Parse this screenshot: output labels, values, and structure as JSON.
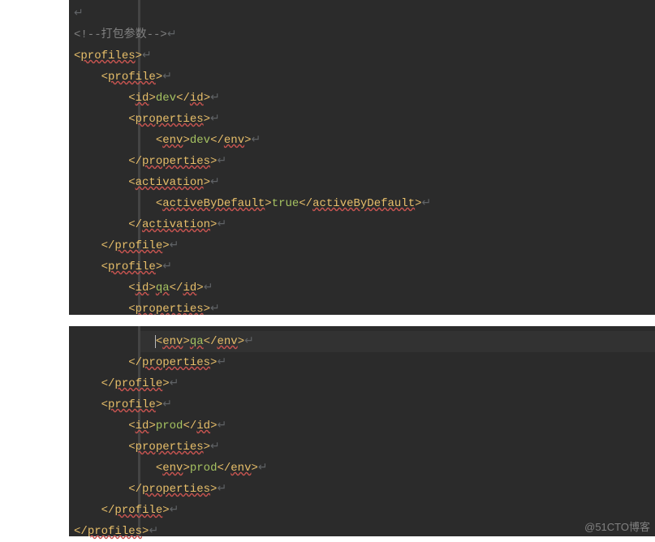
{
  "watermark": "@51CTO博客",
  "arrow_glyph": "↵",
  "lines": [
    {
      "indent": 0,
      "parts": [
        {
          "cls": "arr",
          "text": "↵"
        }
      ]
    },
    {
      "indent": 0,
      "parts": [
        {
          "cls": "cmt",
          "text": "<!--打包参数-->"
        },
        {
          "cls": "arr",
          "text": "↵"
        }
      ]
    },
    {
      "indent": 0,
      "parts": [
        {
          "cls": "tag",
          "text": "<"
        },
        {
          "cls": "tag err",
          "text": "profiles"
        },
        {
          "cls": "tag",
          "text": ">"
        },
        {
          "cls": "arr",
          "text": "↵"
        }
      ]
    },
    {
      "indent": 1,
      "parts": [
        {
          "cls": "tag",
          "text": "<"
        },
        {
          "cls": "tag err",
          "text": "profile"
        },
        {
          "cls": "tag",
          "text": ">"
        },
        {
          "cls": "arr",
          "text": "↵"
        }
      ]
    },
    {
      "indent": 2,
      "parts": [
        {
          "cls": "tag",
          "text": "<"
        },
        {
          "cls": "tag err",
          "text": "id"
        },
        {
          "cls": "tag",
          "text": ">"
        },
        {
          "cls": "text",
          "text": "dev"
        },
        {
          "cls": "tag",
          "text": "</"
        },
        {
          "cls": "tag err",
          "text": "id"
        },
        {
          "cls": "tag",
          "text": ">"
        },
        {
          "cls": "arr",
          "text": "↵"
        }
      ]
    },
    {
      "indent": 2,
      "parts": [
        {
          "cls": "tag",
          "text": "<"
        },
        {
          "cls": "tag err",
          "text": "properties"
        },
        {
          "cls": "tag",
          "text": ">"
        },
        {
          "cls": "arr",
          "text": "↵"
        }
      ]
    },
    {
      "indent": 3,
      "parts": [
        {
          "cls": "tag",
          "text": "<"
        },
        {
          "cls": "tag err",
          "text": "env"
        },
        {
          "cls": "tag",
          "text": ">"
        },
        {
          "cls": "text",
          "text": "dev"
        },
        {
          "cls": "tag",
          "text": "</"
        },
        {
          "cls": "tag err",
          "text": "env"
        },
        {
          "cls": "tag",
          "text": ">"
        },
        {
          "cls": "arr",
          "text": "↵"
        }
      ]
    },
    {
      "indent": 2,
      "parts": [
        {
          "cls": "tag",
          "text": "</"
        },
        {
          "cls": "tag err",
          "text": "properties"
        },
        {
          "cls": "tag",
          "text": ">"
        },
        {
          "cls": "arr",
          "text": "↵"
        }
      ]
    },
    {
      "indent": 2,
      "parts": [
        {
          "cls": "tag",
          "text": "<"
        },
        {
          "cls": "tag err",
          "text": "activation"
        },
        {
          "cls": "tag",
          "text": ">"
        },
        {
          "cls": "arr",
          "text": "↵"
        }
      ]
    },
    {
      "indent": 3,
      "parts": [
        {
          "cls": "tag",
          "text": "<"
        },
        {
          "cls": "tag err",
          "text": "activeByDefault"
        },
        {
          "cls": "tag",
          "text": ">"
        },
        {
          "cls": "text",
          "text": "true"
        },
        {
          "cls": "tag",
          "text": "</"
        },
        {
          "cls": "tag err",
          "text": "activeByDefault"
        },
        {
          "cls": "tag",
          "text": ">"
        },
        {
          "cls": "arr",
          "text": "↵"
        }
      ]
    },
    {
      "indent": 2,
      "parts": [
        {
          "cls": "tag",
          "text": "</"
        },
        {
          "cls": "tag err",
          "text": "activation"
        },
        {
          "cls": "tag",
          "text": ">"
        },
        {
          "cls": "arr",
          "text": "↵"
        }
      ]
    },
    {
      "indent": 1,
      "parts": [
        {
          "cls": "tag",
          "text": "</"
        },
        {
          "cls": "tag err",
          "text": "profile"
        },
        {
          "cls": "tag",
          "text": ">"
        },
        {
          "cls": "arr",
          "text": "↵"
        }
      ]
    },
    {
      "indent": 1,
      "parts": [
        {
          "cls": "tag",
          "text": "<"
        },
        {
          "cls": "tag err",
          "text": "profile"
        },
        {
          "cls": "tag",
          "text": ">"
        },
        {
          "cls": "arr",
          "text": "↵"
        }
      ]
    },
    {
      "indent": 2,
      "parts": [
        {
          "cls": "tag",
          "text": "<"
        },
        {
          "cls": "tag err",
          "text": "id"
        },
        {
          "cls": "tag",
          "text": ">"
        },
        {
          "cls": "text err",
          "text": "qa"
        },
        {
          "cls": "tag",
          "text": "</"
        },
        {
          "cls": "tag err",
          "text": "id"
        },
        {
          "cls": "tag",
          "text": ">"
        },
        {
          "cls": "arr",
          "text": "↵"
        }
      ]
    },
    {
      "indent": 2,
      "parts": [
        {
          "cls": "tag",
          "text": "<"
        },
        {
          "cls": "tag err",
          "text": "properties"
        },
        {
          "cls": "tag",
          "text": ">"
        },
        {
          "cls": "arr",
          "text": "↵"
        }
      ]
    },
    {
      "indent": 3,
      "caret": true,
      "parts": [
        {
          "cls": "tag",
          "text": "<"
        },
        {
          "cls": "tag err",
          "text": "env"
        },
        {
          "cls": "tag",
          "text": ">"
        },
        {
          "cls": "text err",
          "text": "qa"
        },
        {
          "cls": "tag",
          "text": "</"
        },
        {
          "cls": "tag err",
          "text": "env"
        },
        {
          "cls": "tag",
          "text": ">"
        },
        {
          "cls": "arr",
          "text": "↵"
        }
      ]
    },
    {
      "indent": 2,
      "parts": [
        {
          "cls": "tag",
          "text": "</"
        },
        {
          "cls": "tag err",
          "text": "properties"
        },
        {
          "cls": "tag",
          "text": ">"
        },
        {
          "cls": "arr",
          "text": "↵"
        }
      ]
    },
    {
      "indent": 1,
      "parts": [
        {
          "cls": "tag",
          "text": "</"
        },
        {
          "cls": "tag err",
          "text": "profile"
        },
        {
          "cls": "tag",
          "text": ">"
        },
        {
          "cls": "arr",
          "text": "↵"
        }
      ]
    },
    {
      "indent": 1,
      "parts": [
        {
          "cls": "tag",
          "text": "<"
        },
        {
          "cls": "tag err",
          "text": "profile"
        },
        {
          "cls": "tag",
          "text": ">"
        },
        {
          "cls": "arr",
          "text": "↵"
        }
      ]
    },
    {
      "indent": 2,
      "parts": [
        {
          "cls": "tag",
          "text": "<"
        },
        {
          "cls": "tag err",
          "text": "id"
        },
        {
          "cls": "tag",
          "text": ">"
        },
        {
          "cls": "text",
          "text": "prod"
        },
        {
          "cls": "tag",
          "text": "</"
        },
        {
          "cls": "tag err",
          "text": "id"
        },
        {
          "cls": "tag",
          "text": ">"
        },
        {
          "cls": "arr",
          "text": "↵"
        }
      ]
    },
    {
      "indent": 2,
      "parts": [
        {
          "cls": "tag",
          "text": "<"
        },
        {
          "cls": "tag err",
          "text": "properties"
        },
        {
          "cls": "tag",
          "text": ">"
        },
        {
          "cls": "arr",
          "text": "↵"
        }
      ]
    },
    {
      "indent": 3,
      "parts": [
        {
          "cls": "tag",
          "text": "<"
        },
        {
          "cls": "tag err",
          "text": "env"
        },
        {
          "cls": "tag",
          "text": ">"
        },
        {
          "cls": "text",
          "text": "prod"
        },
        {
          "cls": "tag",
          "text": "</"
        },
        {
          "cls": "tag err",
          "text": "env"
        },
        {
          "cls": "tag",
          "text": ">"
        },
        {
          "cls": "arr",
          "text": "↵"
        }
      ]
    },
    {
      "indent": 2,
      "parts": [
        {
          "cls": "tag",
          "text": "</"
        },
        {
          "cls": "tag err",
          "text": "properties"
        },
        {
          "cls": "tag",
          "text": ">"
        },
        {
          "cls": "arr",
          "text": "↵"
        }
      ]
    },
    {
      "indent": 1,
      "parts": [
        {
          "cls": "tag",
          "text": "</"
        },
        {
          "cls": "tag err",
          "text": "profile"
        },
        {
          "cls": "tag",
          "text": ">"
        },
        {
          "cls": "arr",
          "text": "↵"
        }
      ]
    },
    {
      "indent": 0,
      "parts": [
        {
          "cls": "tag",
          "text": "</"
        },
        {
          "cls": "tag err",
          "text": "profiles"
        },
        {
          "cls": "tag",
          "text": ">"
        },
        {
          "cls": "arr",
          "text": "↵"
        }
      ]
    }
  ],
  "split_line_index": 15,
  "indent_unit": "    "
}
